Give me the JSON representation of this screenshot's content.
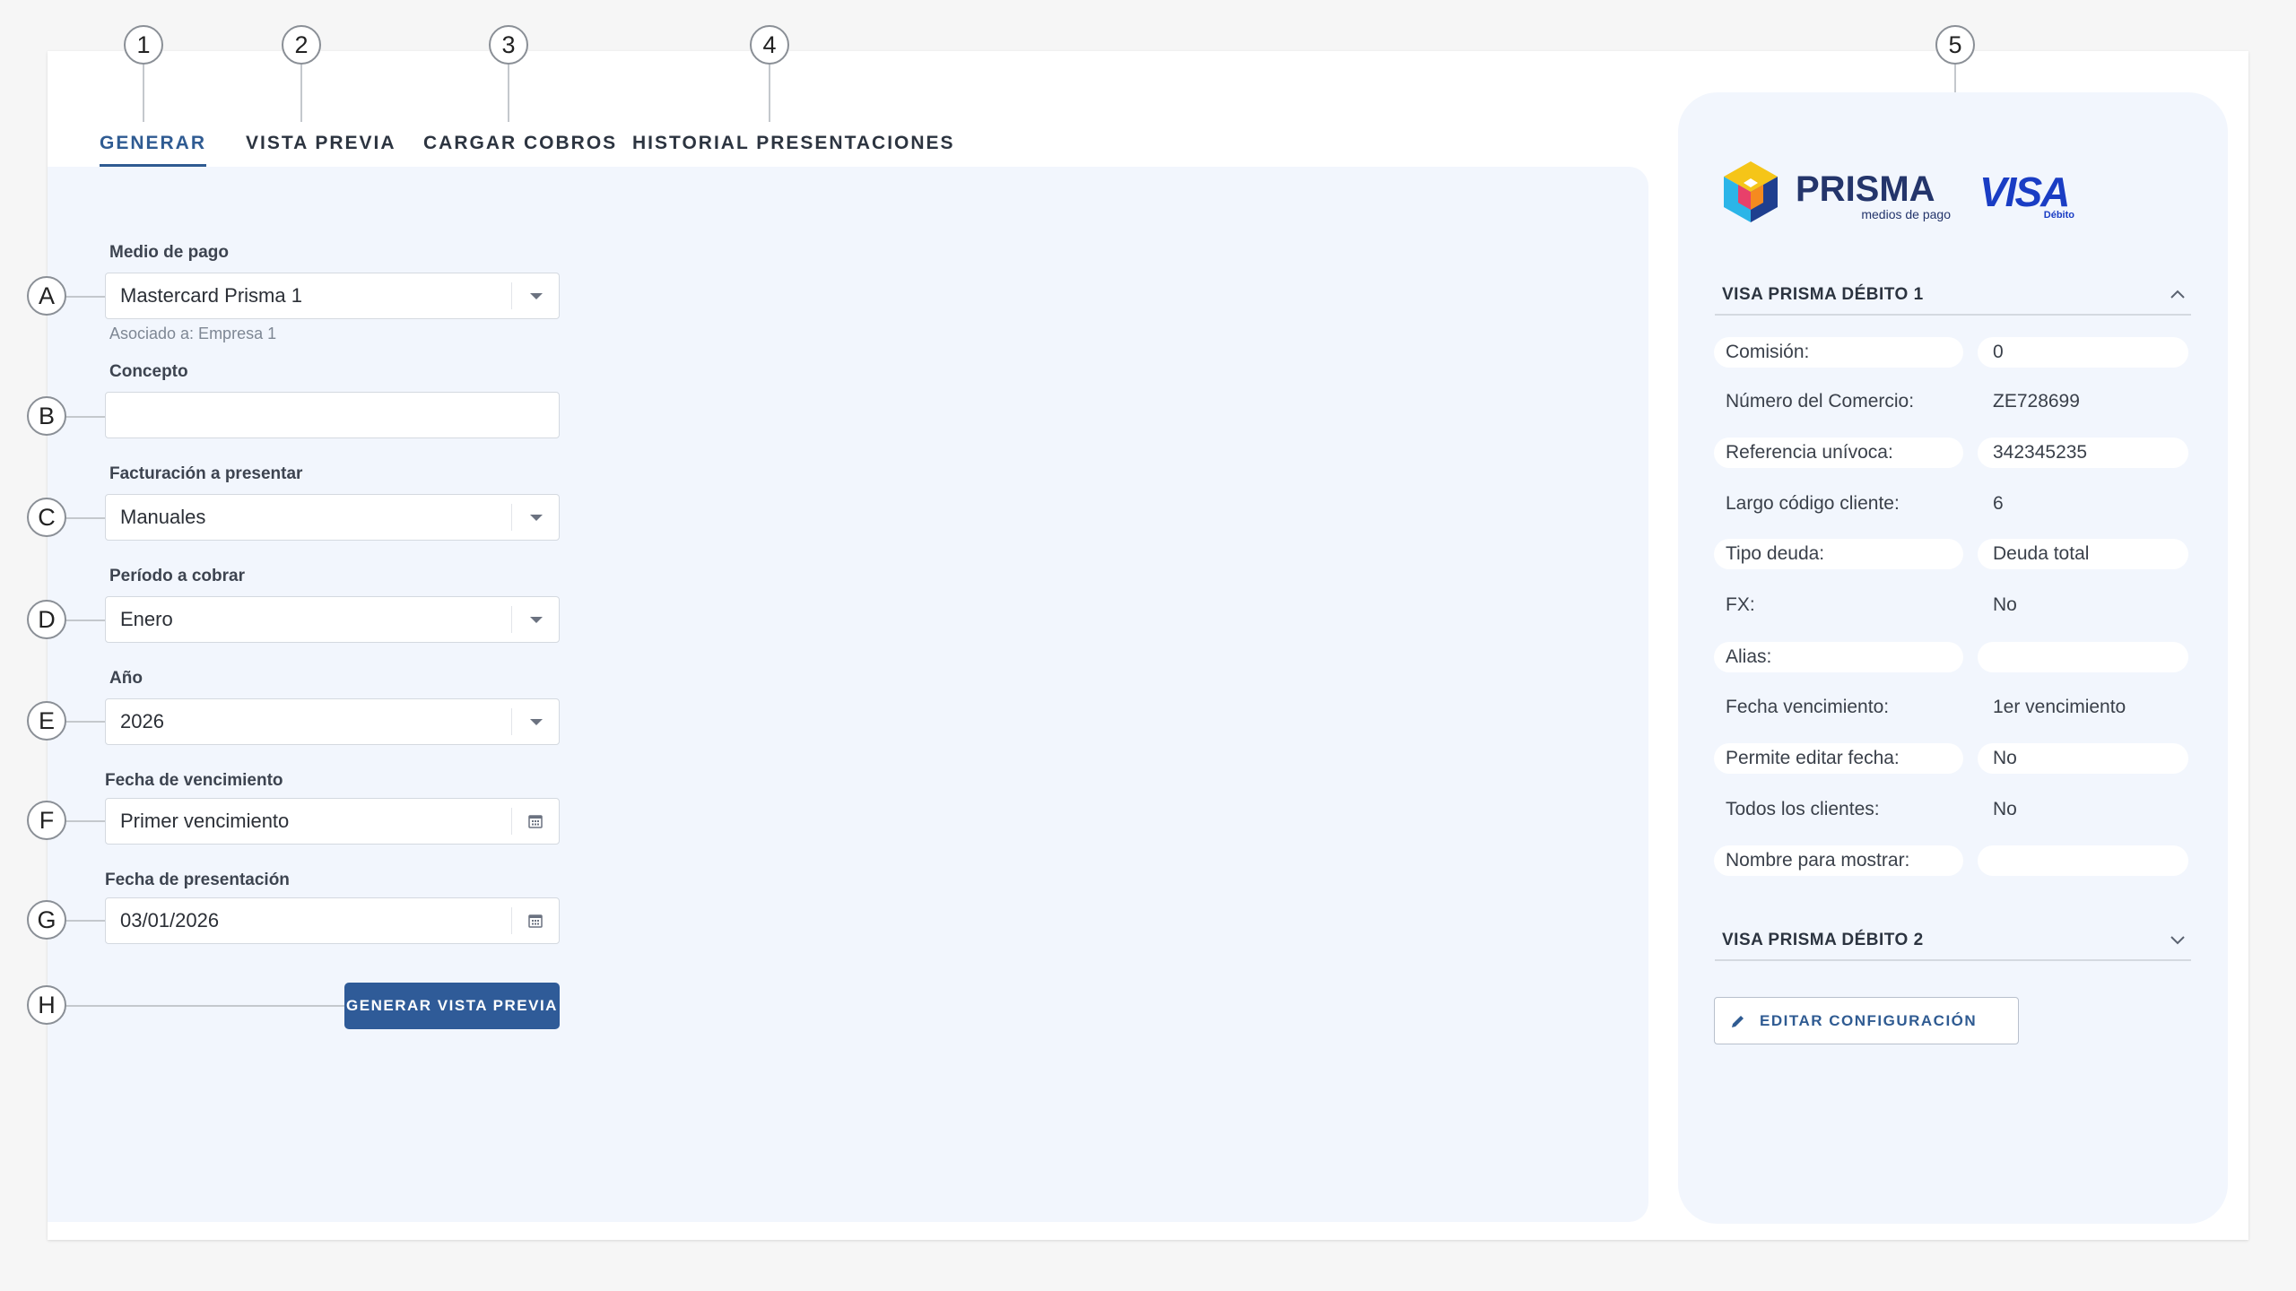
{
  "tabs": [
    {
      "label": "GENERAR",
      "active": true,
      "callout": "1"
    },
    {
      "label": "VISTA PREVIA",
      "active": false,
      "callout": "2"
    },
    {
      "label": "CARGAR COBROS",
      "active": false,
      "callout": "3"
    },
    {
      "label": "HISTORIAL PRESENTACIONES",
      "active": false,
      "callout": "4"
    }
  ],
  "right_panel_callout": "5",
  "form": {
    "medio_pago": {
      "callout": "A",
      "label": "Medio de pago",
      "value": "Mastercard Prisma 1",
      "help": "Asociado a: Empresa 1"
    },
    "concepto": {
      "callout": "B",
      "label": "Concepto",
      "value": ""
    },
    "facturacion": {
      "callout": "C",
      "label": "Facturación a presentar",
      "value": "Manuales"
    },
    "periodo": {
      "callout": "D",
      "label": "Período a cobrar",
      "value": "Enero"
    },
    "anio": {
      "callout": "E",
      "label": "Año",
      "value": "2026"
    },
    "fecha_vencimiento": {
      "callout": "F",
      "label": "Fecha de vencimiento",
      "value": "Primer vencimiento"
    },
    "fecha_presentacion": {
      "callout": "G",
      "label": "Fecha de presentación",
      "value": "03/01/2026"
    },
    "generate_button": {
      "callout": "H",
      "label": "GENERAR VISTA PREVIA"
    }
  },
  "brand": {
    "prisma_name": "PRISMA",
    "prisma_tagline": "medios de pago",
    "visa_name": "VISA",
    "visa_sub": "Débito",
    "colors": {
      "primary": "#2f5b92",
      "visa_blue": "#1a3dc4",
      "prisma_navy": "#24356b"
    }
  },
  "config": {
    "section1_title": "VISA PRISMA DÉBITO 1",
    "section2_title": "VISA PRISMA DÉBITO 2",
    "rows": [
      {
        "label": "Comisión:",
        "value": "0"
      },
      {
        "label": "Número del Comercio:",
        "value": "ZE728699"
      },
      {
        "label": "Referencia unívoca:",
        "value": "342345235"
      },
      {
        "label": "Largo código cliente:",
        "value": "6"
      },
      {
        "label": "Tipo deuda:",
        "value": "Deuda total"
      },
      {
        "label": "FX:",
        "value": "No"
      },
      {
        "label": "Alias:",
        "value": ""
      },
      {
        "label": "Fecha vencimiento:",
        "value": "1er vencimiento"
      },
      {
        "label": "Permite editar fecha:",
        "value": "No"
      },
      {
        "label": "Todos los clientes:",
        "value": "No"
      },
      {
        "label": "Nombre para mostrar:",
        "value": ""
      }
    ],
    "edit_button": "EDITAR CONFIGURACIÓN"
  }
}
